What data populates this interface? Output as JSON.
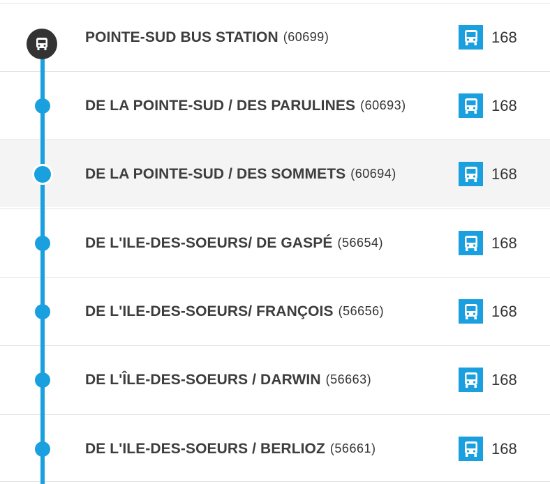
{
  "stops": [
    {
      "name": "POINTE-SUD BUS STATION",
      "code": "(60699)",
      "route": "168",
      "marker": "terminal",
      "highlighted": false
    },
    {
      "name": "DE LA POINTE-SUD / DES PARULINES",
      "code": "(60693)",
      "route": "168",
      "marker": "stop",
      "highlighted": false
    },
    {
      "name": "DE LA POINTE-SUD / DES SOMMETS",
      "code": "(60694)",
      "route": "168",
      "marker": "selected",
      "highlighted": true
    },
    {
      "name": "DE L'ILE-DES-SOEURS/ DE GASPÉ",
      "code": "(56654)",
      "route": "168",
      "marker": "stop",
      "highlighted": false
    },
    {
      "name": "DE L'ILE-DES-SOEURS/ FRANÇOIS",
      "code": "(56656)",
      "route": "168",
      "marker": "stop",
      "highlighted": false
    },
    {
      "name": "DE L'ÎLE-DES-SOEURS / DARWIN",
      "code": "(56663)",
      "route": "168",
      "marker": "stop",
      "highlighted": false
    },
    {
      "name": "DE L'ILE-DES-SOEURS / BERLIOZ",
      "code": "(56661)",
      "route": "168",
      "marker": "stop",
      "highlighted": false
    }
  ],
  "icons": {
    "route": "bus-icon",
    "terminal": "bus-station-icon"
  },
  "colors": {
    "line": "#1a9fdf",
    "text": "#3d3d3d",
    "terminal": "#333333",
    "highlight_row": "#f4f4f4"
  }
}
